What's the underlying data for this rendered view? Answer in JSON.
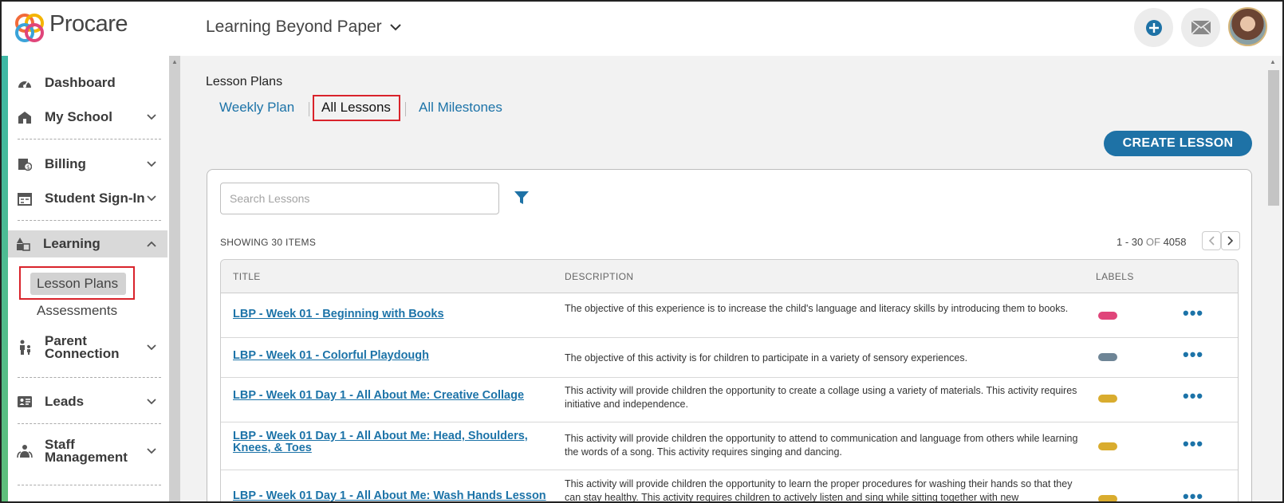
{
  "header": {
    "brand": "Procare",
    "school_name": "Learning Beyond Paper"
  },
  "sidebar": {
    "items": [
      {
        "label": "Dashboard",
        "icon": "dashboard-icon"
      },
      {
        "label": "My School",
        "icon": "school-icon"
      },
      {
        "label": "Billing",
        "icon": "billing-icon"
      },
      {
        "label": "Student Sign-In",
        "icon": "calendar-icon"
      },
      {
        "label": "Learning",
        "icon": "blocks-icon"
      },
      {
        "label": "Parent Connection",
        "icon": "family-icon"
      },
      {
        "label": "Leads",
        "icon": "id-card-icon"
      },
      {
        "label": "Staff Management",
        "icon": "staff-icon"
      }
    ],
    "learning_sub": {
      "lesson_plans": "Lesson Plans",
      "assessments": "Assessments"
    }
  },
  "main": {
    "page_title": "Lesson Plans",
    "tabs": [
      {
        "label": "Weekly Plan"
      },
      {
        "label": "All Lessons"
      },
      {
        "label": "All Milestones"
      }
    ],
    "create_button": "CREATE LESSON",
    "search_placeholder": "Search Lessons",
    "showing": "SHOWING 30 ITEMS",
    "pager": {
      "range": "1 - 30",
      "of": "OF",
      "total": "4058"
    },
    "columns": {
      "title": "TITLE",
      "description": "DESCRIPTION",
      "labels": "LABELS"
    },
    "rows": [
      {
        "title": "LBP - Week 01 - Beginning with Books",
        "description": "The objective of this experience is to increase the child's language and literacy skills by introducing them to books.",
        "label_color": "#e0457a"
      },
      {
        "title": "LBP - Week 01 - Colorful Playdough",
        "description": "The objective of this activity is for children to participate in a variety of sensory experiences.",
        "label_color": "#6e8596"
      },
      {
        "title": "LBP - Week 01 Day 1 - All About Me: Creative Collage",
        "description": "This activity will provide children the opportunity to create a collage using a variety of materials. This activity requires initiative and independence.",
        "label_color": "#d9ac2e"
      },
      {
        "title": "LBP - Week 01 Day 1 - All About Me: Head, Shoulders, Knees, & Toes",
        "description": "This activity will provide children the opportunity to attend to communication and language from others while learning the words of a song. This activity requires singing and dancing.",
        "label_color": "#d9ac2e"
      },
      {
        "title": "LBP - Week 01 Day 1 - All About Me: Wash Hands Lesson",
        "description": "This activity will provide children the opportunity to learn the proper procedures for washing their hands so that they can stay healthy. This activity requires children to actively listen and sing while sitting together with new",
        "label_color": "#d9ac2e"
      }
    ]
  }
}
